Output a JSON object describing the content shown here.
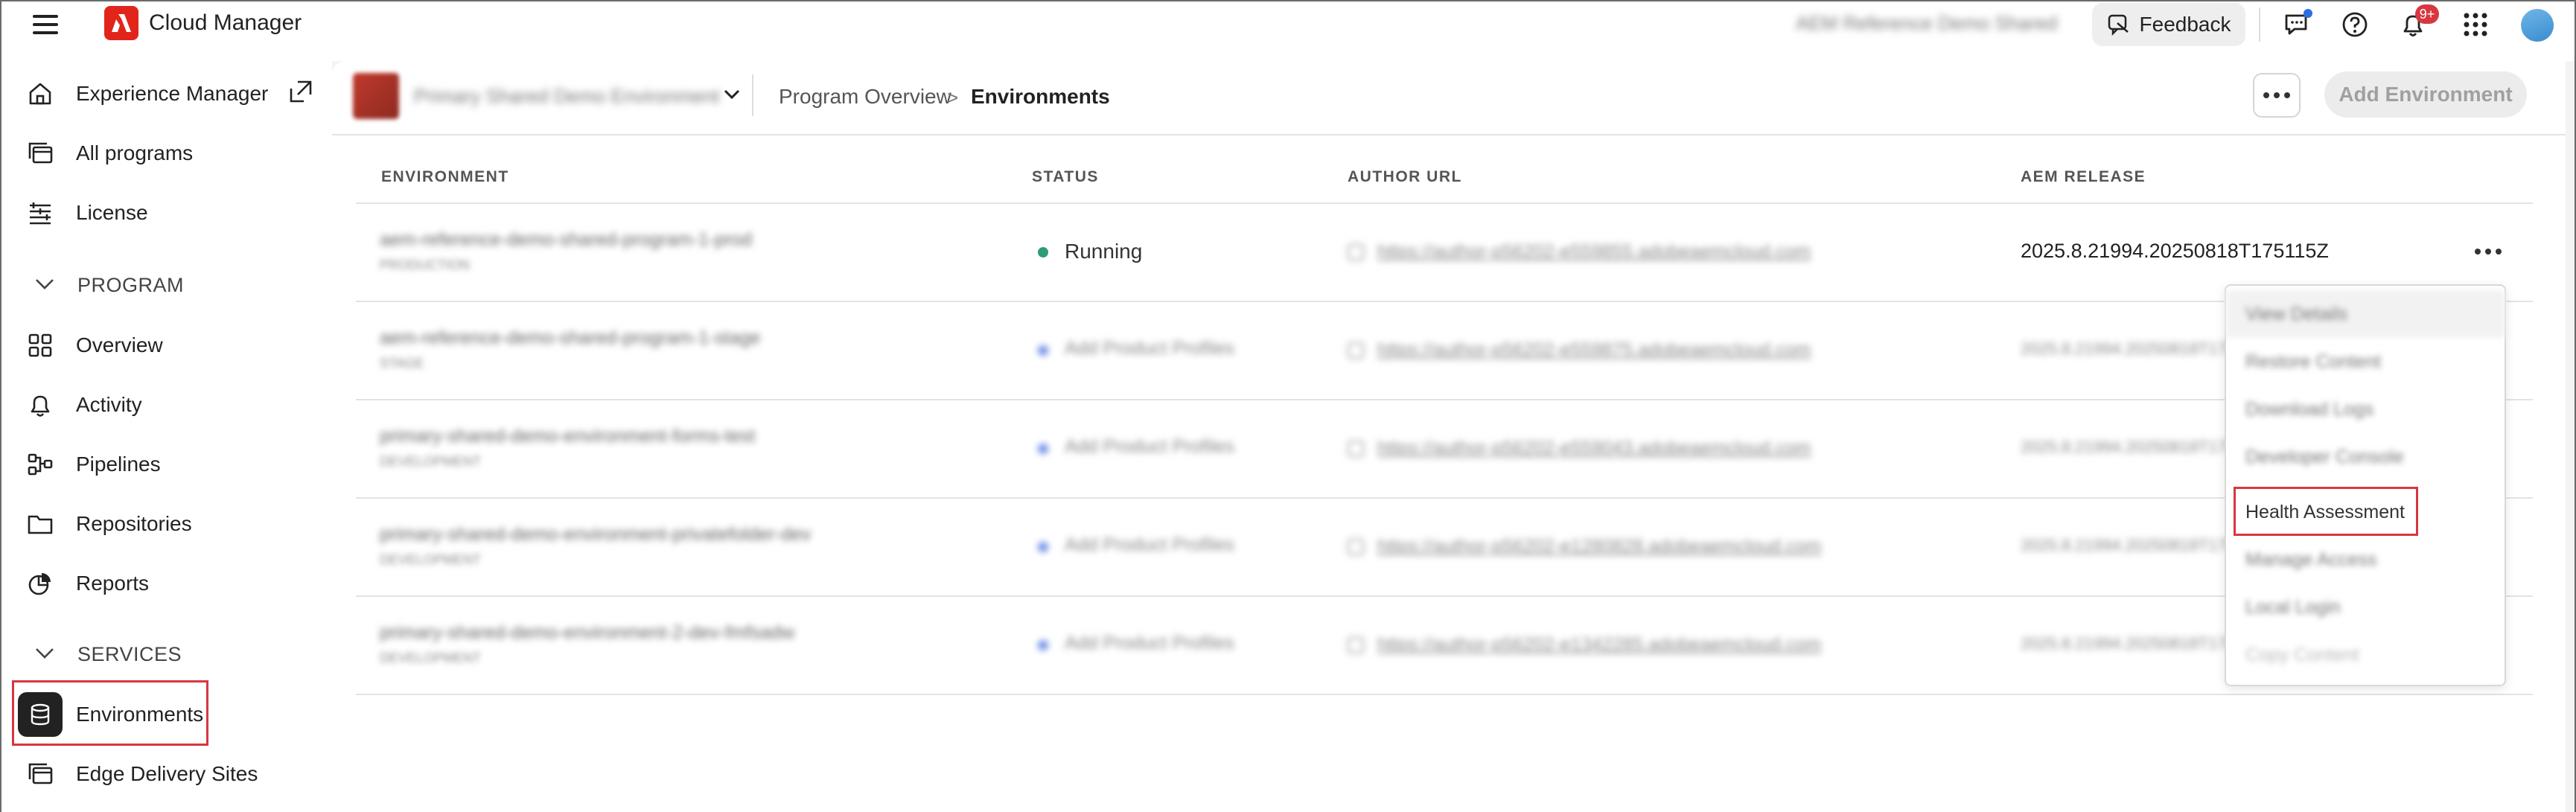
{
  "topbar": {
    "menu_icon": "hamburger-icon",
    "logo_icon": "adobe-logo-icon",
    "app_title": "Cloud Manager",
    "org_name": "AEM Reference Demo Shared",
    "feedback_label": "Feedback",
    "notifications_badge": "9+",
    "icons": [
      "feedback-icon",
      "chat-icon",
      "help-icon",
      "bell-icon",
      "apps-grid-icon",
      "avatar"
    ]
  },
  "sidebar": {
    "items": [
      {
        "label": "Experience Manager",
        "icon": "home-icon"
      },
      {
        "label": "All programs",
        "icon": "programs-icon"
      },
      {
        "label": "License",
        "icon": "license-icon"
      }
    ],
    "program_section": {
      "title": "PROGRAM",
      "items": [
        {
          "label": "Overview",
          "icon": "overview-icon"
        },
        {
          "label": "Activity",
          "icon": "bell-icon"
        },
        {
          "label": "Pipelines",
          "icon": "pipelines-icon"
        },
        {
          "label": "Repositories",
          "icon": "folder-icon"
        },
        {
          "label": "Reports",
          "icon": "reports-icon"
        }
      ]
    },
    "services_section": {
      "title": "SERVICES",
      "items": [
        {
          "label": "Environments",
          "icon": "database-icon",
          "active": true
        },
        {
          "label": "Edge Delivery Sites",
          "icon": "sites-icon"
        }
      ]
    }
  },
  "header": {
    "program_name": "Primary Shared Demo Environment",
    "breadcrumb": [
      "Program Overview",
      "Environments"
    ],
    "breadcrumb_separator": ">",
    "add_environment_label": "Add Environment"
  },
  "table": {
    "columns": [
      "ENVIRONMENT",
      "STATUS",
      "AUTHOR URL",
      "AEM RELEASE"
    ],
    "rows": [
      {
        "name": "aem-reference-demo-shared-program-1-prod",
        "type": "PRODUCTION",
        "status": "Running",
        "url": "https://author-p56202-e559855.adobeaemcloud.com",
        "release": "2025.8.21994.20250818T175115Z"
      },
      {
        "name": "aem-reference-demo-shared-program-1-stage",
        "type": "STAGE",
        "status": "Add Product Profiles",
        "url": "https://author-p56202-e559875.adobeaemcloud.com",
        "release": "2025.8.21994.20250818T175115Z"
      },
      {
        "name": "primary-shared-demo-environment-forms-test",
        "type": "DEVELOPMENT",
        "status": "Add Product Profiles",
        "url": "https://author-p56202-e559043.adobeaemcloud.com",
        "release": "2025.8.21994.20250818T175115Z"
      },
      {
        "name": "primary-shared-demo-environment-privatefolder-dev",
        "type": "DEVELOPMENT",
        "status": "Add Product Profiles",
        "url": "https://author-p56202-e1280828.adobeaemcloud.com",
        "release": "2025.8.21994.20250818T175115Z"
      },
      {
        "name": "primary-shared-demo-environment-2-dev-fmfsadw",
        "type": "DEVELOPMENT",
        "status": "Add Product Profiles",
        "url": "https://author-p56202-e1342285.adobeaemcloud.com",
        "release": "2025.8.21994.20250818T175115Z"
      }
    ]
  },
  "menu": {
    "items": [
      "View Details",
      "Restore Content",
      "Download Logs",
      "Developer Console",
      "Health Assessment",
      "Manage Access",
      "Local Login",
      "Copy Content"
    ]
  },
  "colors": {
    "highlight": "#d7373f",
    "running": "#2d9d78",
    "pending": "#6e8ee8",
    "brand": "#e1251b"
  }
}
